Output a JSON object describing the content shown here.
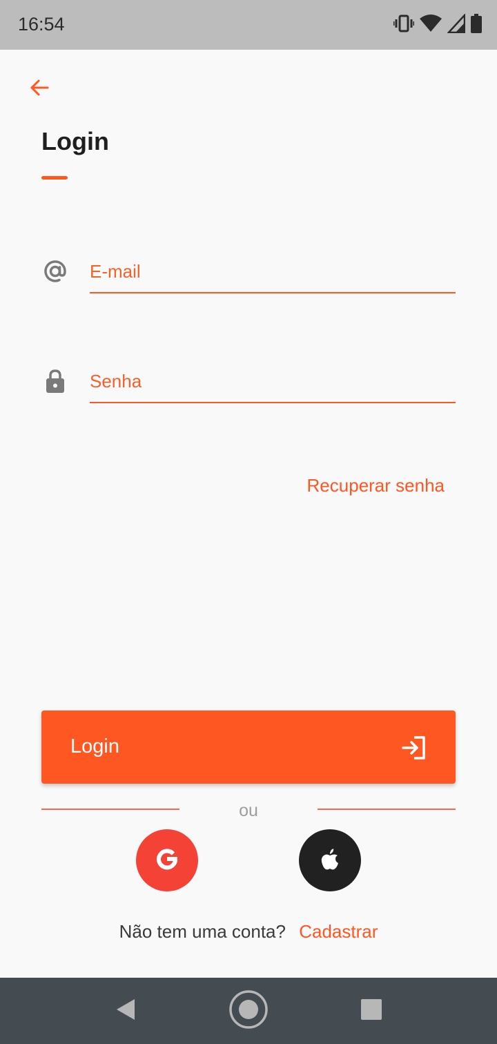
{
  "status_bar": {
    "time": "16:54",
    "icons": [
      "vibrate-icon",
      "wifi-icon",
      "signal-icon",
      "battery-icon"
    ]
  },
  "header": {
    "back_icon": "arrow-left-icon",
    "title": "Login"
  },
  "form": {
    "email": {
      "icon": "at-sign-icon",
      "placeholder": "E-mail",
      "value": ""
    },
    "password": {
      "icon": "lock-icon",
      "placeholder": "Senha",
      "value": ""
    },
    "recover_label": "Recuperar senha"
  },
  "login_button": {
    "label": "Login",
    "icon": "login-arrow-icon"
  },
  "divider": {
    "text": "ou"
  },
  "social": [
    {
      "name": "google",
      "icon": "google-icon",
      "color": "#f44336"
    },
    {
      "name": "apple",
      "icon": "apple-icon",
      "color": "#212121"
    }
  ],
  "signup": {
    "question": "Não tem uma conta?",
    "link": "Cadastrar"
  },
  "nav_bar": {
    "buttons": [
      "back-triangle-icon",
      "home-circle-icon",
      "recents-square-icon"
    ]
  },
  "colors": {
    "accent": "#ff5722",
    "icon_gray": "#7a7a7a",
    "background": "#f9f9f9",
    "nav_bar": "#444b51",
    "status_bar": "#bcbcbc"
  }
}
